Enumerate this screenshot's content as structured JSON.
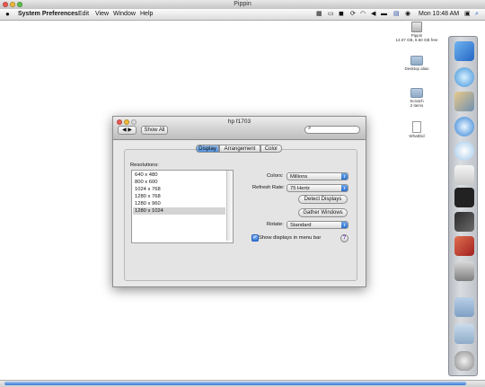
{
  "window": {
    "title": "Pippin"
  },
  "menubar": {
    "apple": "",
    "app_name": "System Preferences",
    "items": [
      "Edit",
      "View",
      "Window",
      "Help"
    ],
    "clock": "Mon 10:48 AM"
  },
  "desktop": {
    "icons": [
      {
        "name": "Pippin",
        "sub": "14.07 GB, 8.60 GB free",
        "kind": "drive"
      },
      {
        "name": "Desktop alias",
        "sub": "",
        "kind": "folder"
      },
      {
        "name": "Scratch",
        "sub": "2 items",
        "kind": "folder"
      },
      {
        "name": "WhatDid",
        "sub": "",
        "kind": "doc"
      }
    ]
  },
  "prefs": {
    "title": "hp f1703",
    "show_all": "Show All",
    "search_placeholder": "",
    "tabs": [
      "Display",
      "Arrangement",
      "Color"
    ],
    "active_tab": "Display",
    "resolutions_label": "Resolutions:",
    "resolutions": [
      "640 x 480",
      "800 x 600",
      "1024 x 768",
      "1280 x 768",
      "1280 x 960",
      "1280 x 1024"
    ],
    "selected_resolution": "1280 x 1024",
    "colors_label": "Colors:",
    "colors_value": "Millions",
    "refresh_label": "Refresh Rate:",
    "refresh_value": "75 Hertz",
    "detect_button": "Detect Displays",
    "gather_button": "Gather Windows",
    "rotate_label": "Rotate:",
    "rotate_value": "Standard",
    "menu_checkbox_label": "Show displays in menu bar",
    "menu_checkbox_checked": true,
    "help": "?"
  }
}
